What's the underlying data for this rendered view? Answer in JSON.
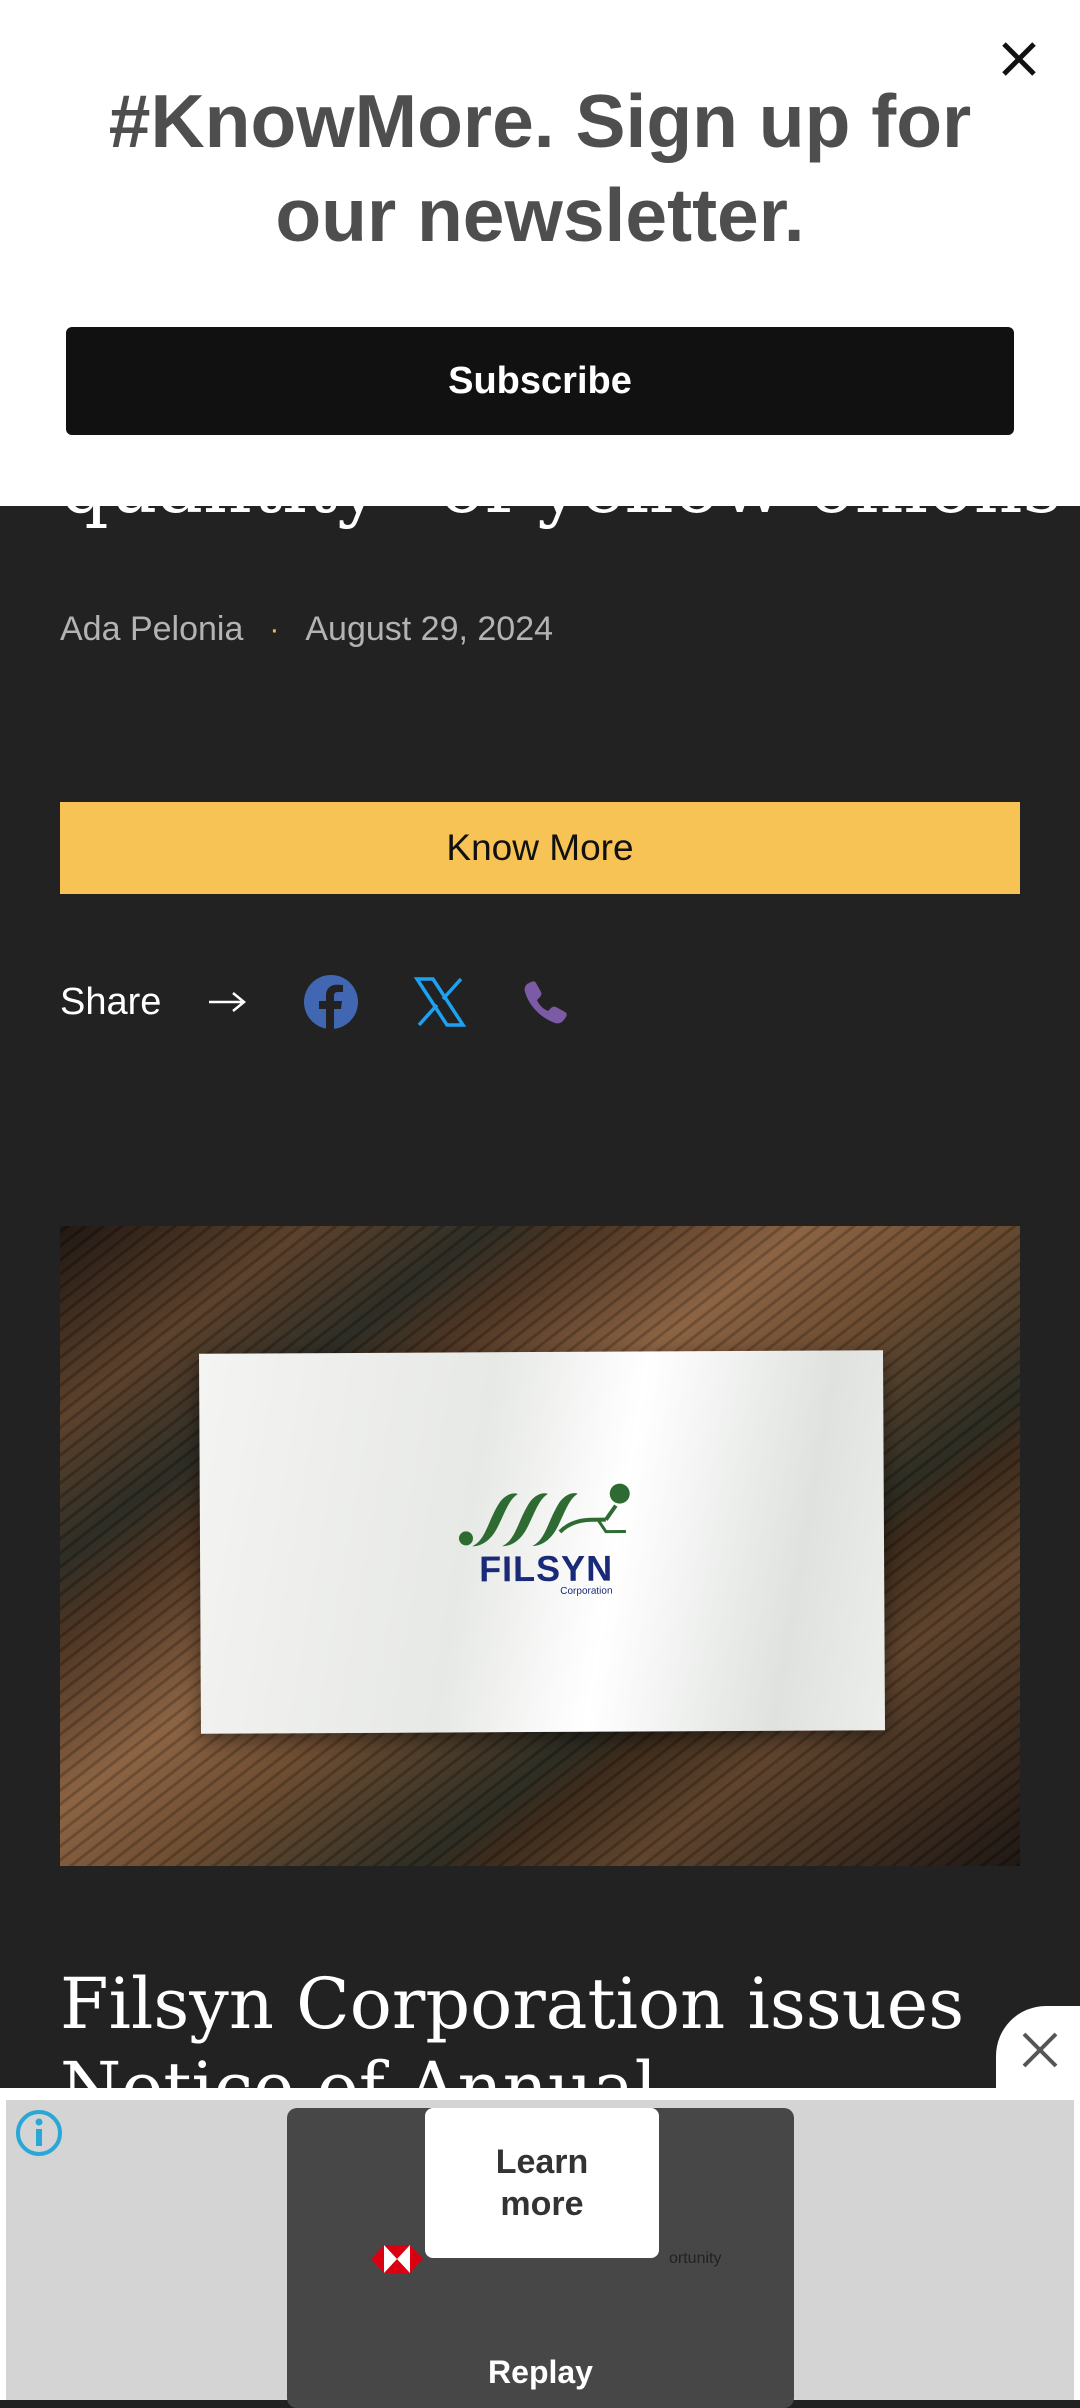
{
  "modal": {
    "title": "#KnowMore. Sign up for our newsletter.",
    "subscribe_label": "Subscribe",
    "close_icon": "close-icon"
  },
  "article": {
    "headline_visible_tail": "quantity\" of yellow onions",
    "author": "Ada Pelonia",
    "separator": "·",
    "date": "August 29, 2024",
    "know_more_label": "Know More",
    "share_label": "Share",
    "share_icons": [
      "arrow-right-icon",
      "facebook-icon",
      "x-icon",
      "phone-icon"
    ],
    "colors": {
      "accent_yellow": "#F6C354",
      "facebook": "#4267B2",
      "x": "#1DA1F2",
      "phone": "#7B5BA6"
    }
  },
  "next_article": {
    "image_logo_text": "FILSYN",
    "image_logo_subtext": "Corporation",
    "headline": "Filsyn Corporation issues Notice of Annual"
  },
  "ad": {
    "learn_more_label": "Learn more",
    "replay_label": "Replay",
    "faint_text": "ortunity",
    "info_icon": "info-icon",
    "close_icon": "close-icon"
  }
}
